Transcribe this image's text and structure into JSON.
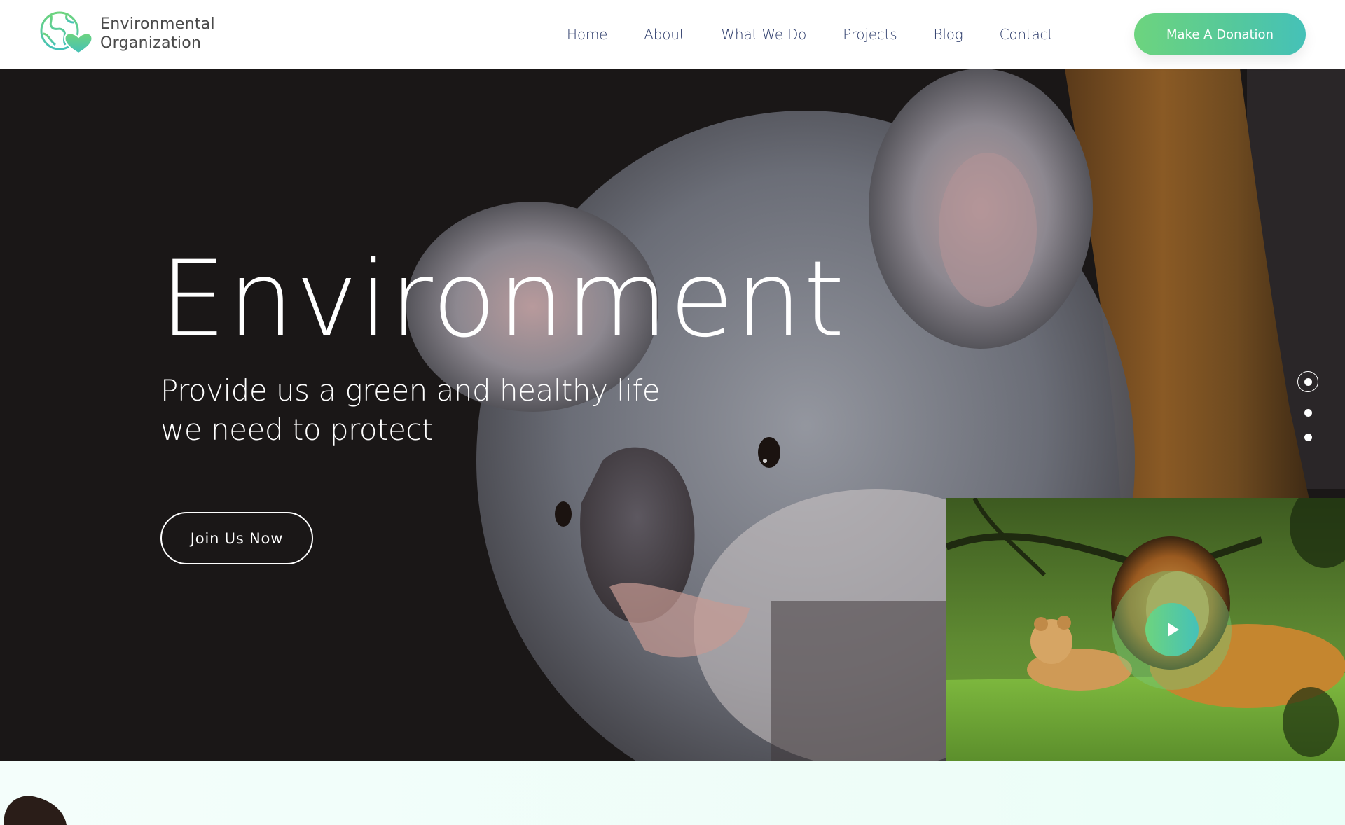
{
  "brand": {
    "name_line1": "Environmental",
    "name_line2": "Organization",
    "logo_icon": "globe-heart-icon"
  },
  "nav": {
    "items": [
      {
        "label": "Home"
      },
      {
        "label": "About"
      },
      {
        "label": "What We Do"
      },
      {
        "label": "Projects"
      },
      {
        "label": "Blog"
      },
      {
        "label": "Contact"
      }
    ],
    "cta_label": "Make A Donation"
  },
  "hero": {
    "title": "Environment",
    "subtitle_line1": "Provide us a green and healthy life",
    "subtitle_line2": "we need to protect",
    "button_label": "Join Us Now",
    "background_image": "koala-on-tree",
    "slides": {
      "count": 3,
      "active_index": 0
    }
  },
  "video": {
    "thumbnail": "lion-and-cub-on-grass",
    "play_icon": "play-icon"
  },
  "colors": {
    "accent_start": "#6dd47e",
    "accent_end": "#45c1b8",
    "nav_text": "#2d3c6b",
    "hero_bg": "#1a1717",
    "section_bg": "#eefdf8"
  }
}
